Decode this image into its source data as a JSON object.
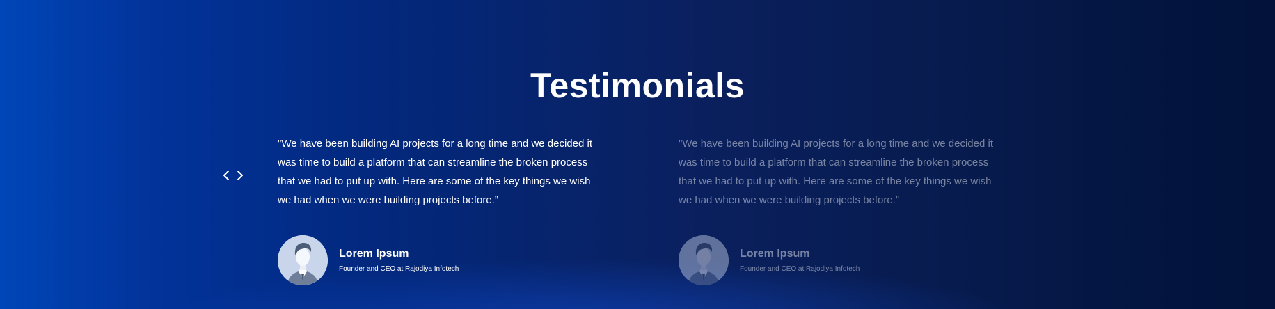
{
  "section": {
    "title": "Testimonials"
  },
  "navigation": {
    "prev_icon": "chevron-left-icon",
    "next_icon": "chevron-right-icon"
  },
  "testimonials": [
    {
      "quote": "\"We have been building AI projects for a long time and we decided it was time to build a platform that can streamline the broken process that we had to put up with. Here are some of the key things we wish we had when we were building projects before.”",
      "name": "Lorem Ipsum",
      "role": "Founder and CEO at Rajodiya Infotech",
      "avatar_icon": "user-avatar-icon",
      "active": true
    },
    {
      "quote": "\"We have been building AI projects for a long time and we decided it was time to build a platform that can streamline the broken process that we had to put up with. Here are some of the key things we wish we had when we were building projects before.”",
      "name": "Lorem Ipsum",
      "role": "Founder and CEO at Rajodiya Infotech",
      "avatar_icon": "user-avatar-icon",
      "active": false
    }
  ],
  "colors": {
    "background_start": "#0046b8",
    "background_end": "#02123a",
    "text": "#ffffff",
    "avatar_bg": "#c8d4ea"
  }
}
